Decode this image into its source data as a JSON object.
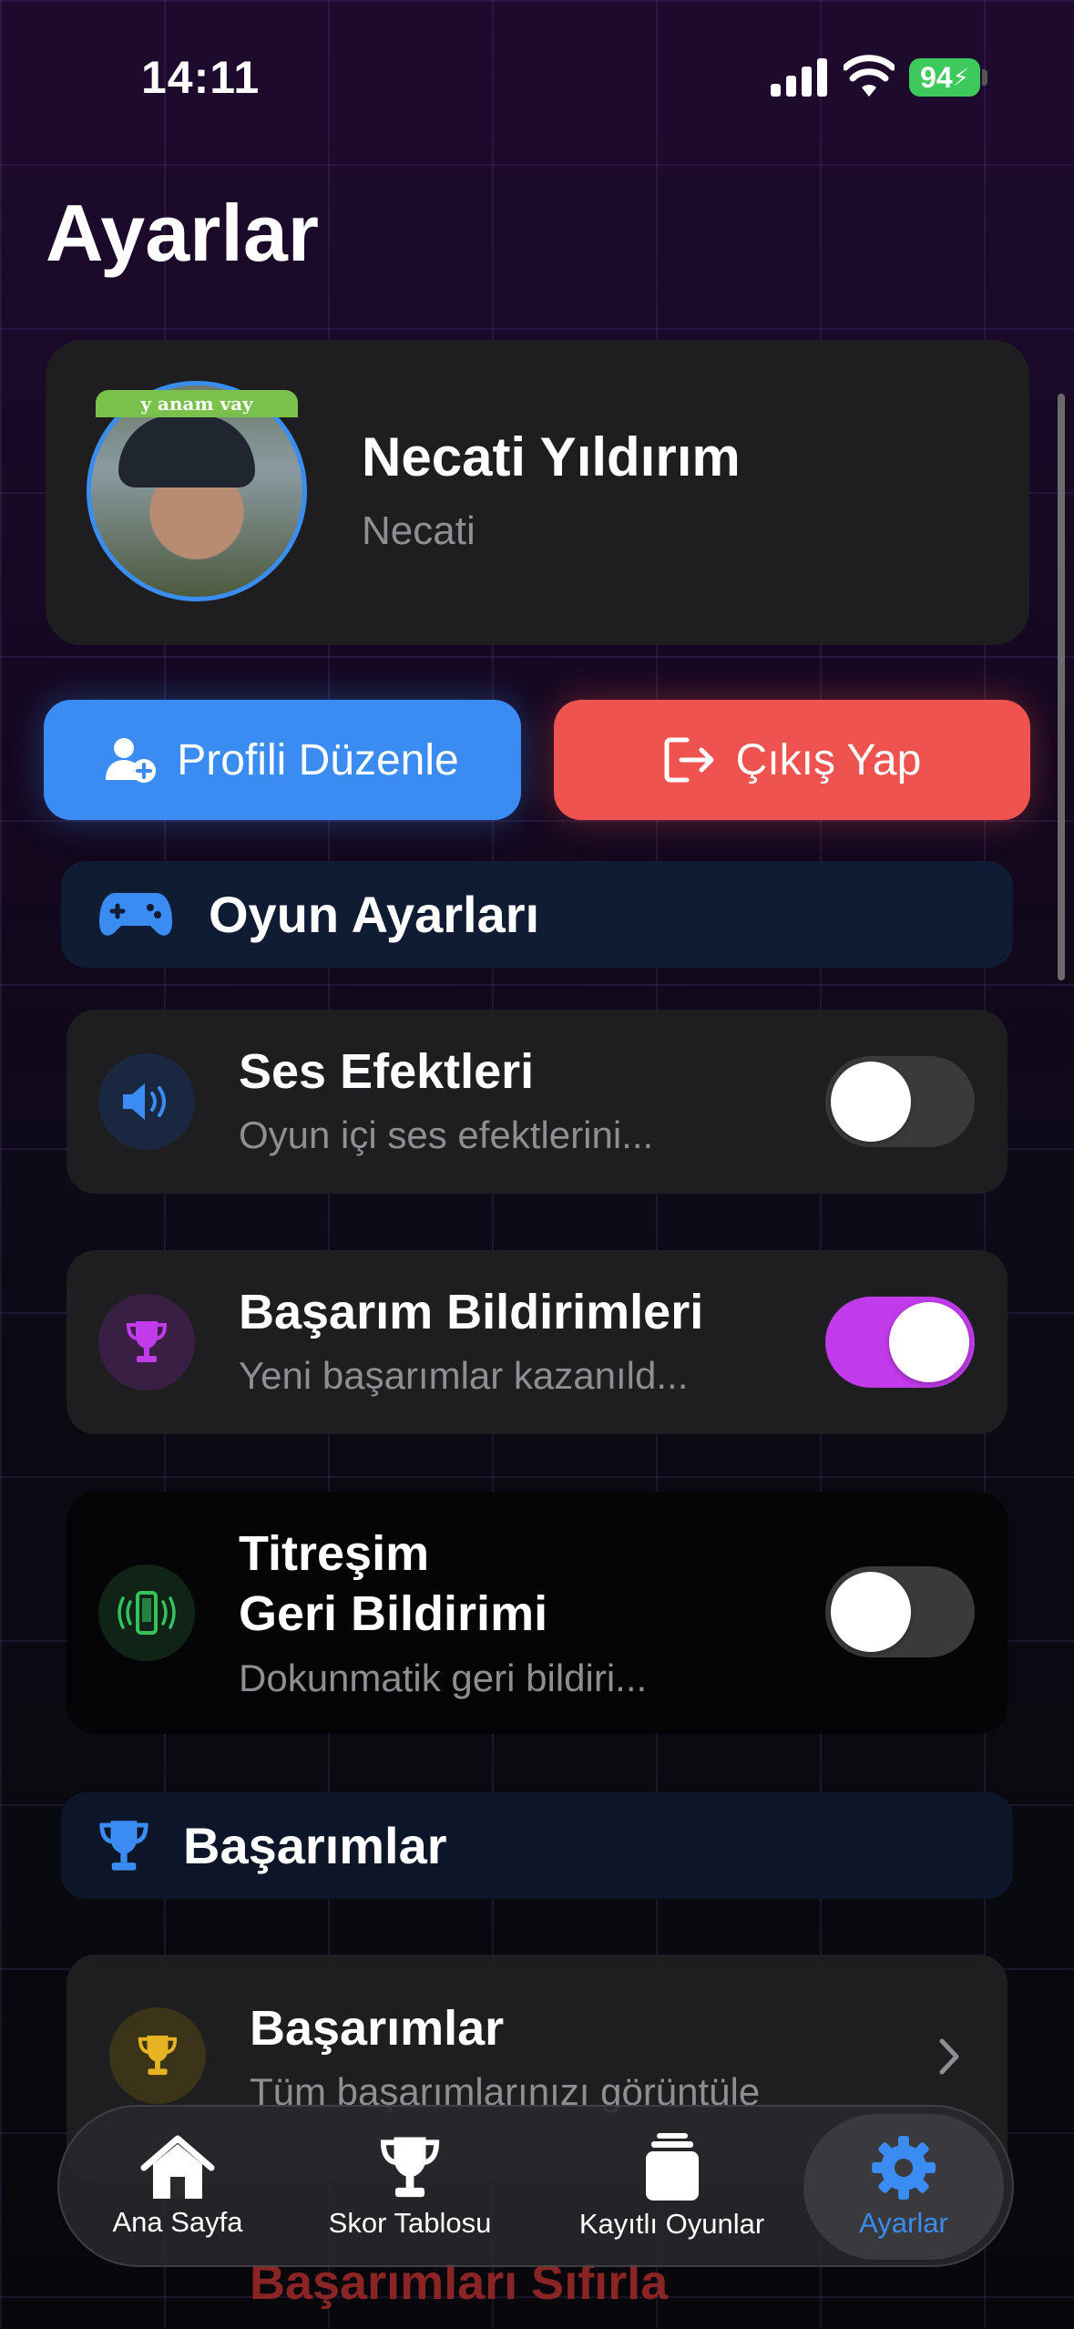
{
  "status_bar": {
    "time": "14:11",
    "battery": "94"
  },
  "page": {
    "title": "Ayarlar"
  },
  "profile": {
    "name": "Necati Yıldırım",
    "username": "Necati",
    "avatar_caption": "y anam vay"
  },
  "actions": {
    "edit_profile": "Profili Düzenle",
    "logout": "Çıkış Yap"
  },
  "game_settings": {
    "header": "Oyun Ayarları",
    "items": [
      {
        "title": "Ses Efektleri",
        "subtitle": "Oyun içi ses efektlerini...",
        "enabled": false,
        "icon": "speaker-icon"
      },
      {
        "title": "Başarım Bildirimleri",
        "subtitle": "Yeni başarımlar kazanıld...",
        "enabled": true,
        "icon": "trophy-icon"
      },
      {
        "title_line1": "Titreşim",
        "title_line2": "Geri Bildirimi",
        "subtitle": "Dokunmatik geri bildiri...",
        "enabled": false,
        "icon": "phone-vibrate-icon"
      }
    ]
  },
  "achievements": {
    "header": "Başarımlar",
    "item": {
      "title": "Başarımlar",
      "subtitle": "Tüm başarımlarınızı görüntüle"
    },
    "reset": "Başarımları Sıfırla"
  },
  "tabbar": {
    "items": [
      {
        "label": "Ana Sayfa",
        "icon": "home-icon"
      },
      {
        "label": "Skor Tablosu",
        "icon": "trophy-icon"
      },
      {
        "label": "Kayıtlı Oyunlar",
        "icon": "stack-icon"
      },
      {
        "label": "Ayarlar",
        "icon": "gear-icon",
        "active": true
      }
    ]
  },
  "colors": {
    "accent_blue": "#3b8cf2",
    "danger_red": "#ef5350",
    "toggle_on": "#c13bea"
  }
}
